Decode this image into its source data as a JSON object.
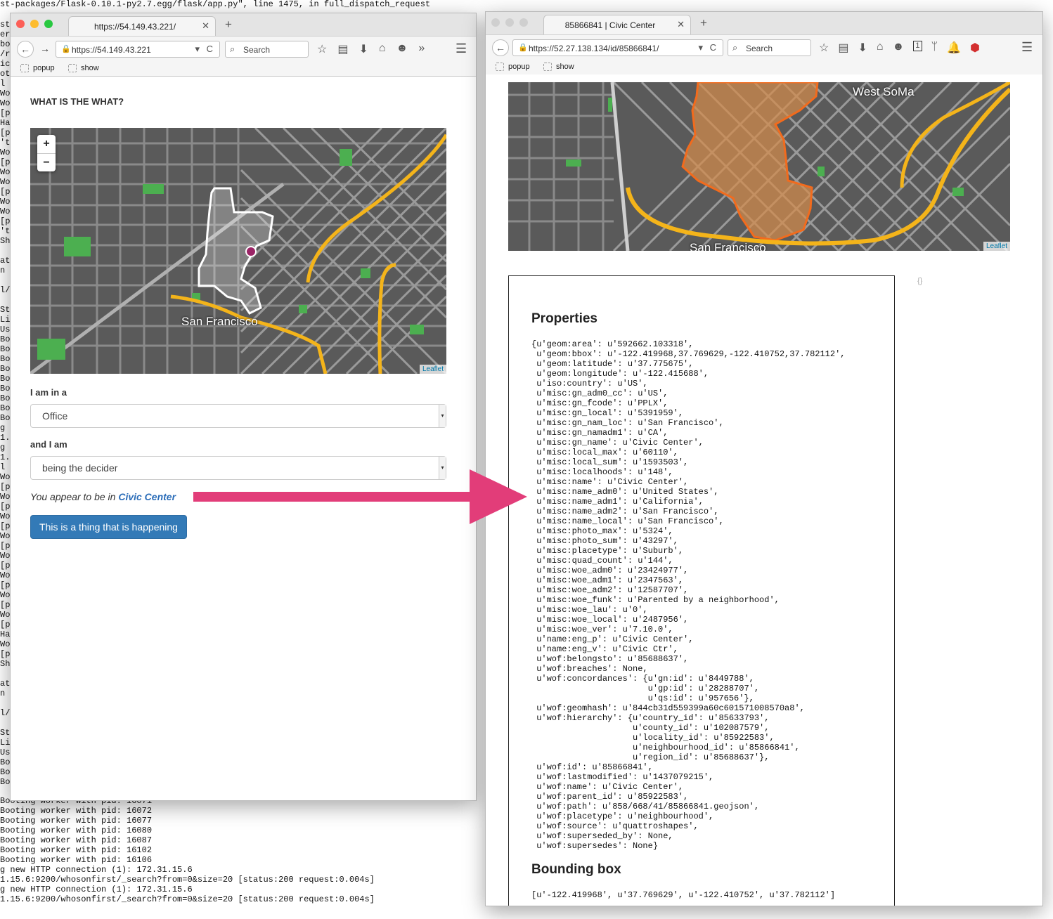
{
  "terminal": {
    "top_line": "st-packages/Flask-0.10.1-py2.7.egg/flask/app.py\", line 1475, in full_dispatch_request",
    "left_fragments": [
      "st-",
      "er",
      "bo",
      "/r",
      "ic",
      "ot",
      "l w",
      "Wor",
      "Wor",
      "[pi",
      "Har",
      "[pi",
      "'th",
      "Wor",
      "[pi",
      "Wor",
      "Wor",
      "[pi",
      "Wor",
      "Wor",
      "[pi",
      "'th",
      "Shu",
      "",
      "ate",
      "n",
      "",
      "l/m",
      "",
      "Sta",
      "Lis",
      "Usi",
      "Boo",
      "Boo",
      "Boo",
      "Boo",
      "Boo",
      "Boo",
      "Boo",
      "Boo",
      "Boo",
      "g n",
      "1.1",
      "g n",
      "1.1",
      "l w",
      "Wor",
      "[pi",
      "Wor",
      "[pi",
      "Wor",
      "[pi",
      "Wor",
      "[pi",
      "Wor",
      "[pi",
      "Wor",
      "[pi",
      "Wor",
      "[pi",
      "Wor",
      "[pi",
      "Har",
      "Wor",
      "[pi",
      "Shu",
      "",
      "ate",
      "n",
      "",
      "l/m",
      "",
      "Sta",
      "Lis",
      "Usi",
      "Boo",
      "Boo",
      "Boo"
    ],
    "bottom_lines": [
      "Booting worker with pid: 16071",
      "Booting worker with pid: 16072",
      "Booting worker with pid: 16077",
      "Booting worker with pid: 16080",
      "Booting worker with pid: 16087",
      "Booting worker with pid: 16102",
      "Booting worker with pid: 16106",
      "g new HTTP connection (1): 172.31.15.6",
      "1.15.6:9200/whosonfirst/_search?from=0&size=20 [status:200 request:0.004s]",
      "g new HTTP connection (1): 172.31.15.6",
      "1.15.6:9200/whosonfirst/_search?from=0&size=20 [status:200 request:0.004s]"
    ]
  },
  "left_browser": {
    "tab_title": "https://54.149.43.221/",
    "url": "https://54.149.43.221",
    "search_placeholder": "Search",
    "bookmarks": [
      "popup",
      "show"
    ],
    "heading": "WHAT IS THE WHAT?",
    "map": {
      "label": "San Francisco",
      "attribution": "Leaflet",
      "zoom_in": "+",
      "zoom_out": "−"
    },
    "field1_label": "I am in a",
    "field1_value": "Office",
    "field2_label": "and I am",
    "field2_value": "being the decider",
    "appear_prefix": "You appear to be in ",
    "appear_place": "Civic Center",
    "button_label": "This is a thing that is happening"
  },
  "right_browser": {
    "tab_title": "85866841 | Civic Center",
    "url": "https://52.27.138.134/id/85866841/",
    "search_placeholder": "Search",
    "badge": "1",
    "bookmarks": [
      "popup",
      "show"
    ],
    "map": {
      "label_top": "West SoMa",
      "label_bottom": "San Francisco",
      "attribution": "Leaflet"
    },
    "braces": "{}",
    "properties_heading": "Properties",
    "properties_text": "{u'geom:area': u'592662.103318',\n u'geom:bbox': u'-122.419968,37.769629,-122.410752,37.782112',\n u'geom:latitude': u'37.775675',\n u'geom:longitude': u'-122.415688',\n u'iso:country': u'US',\n u'misc:gn_adm0_cc': u'US',\n u'misc:gn_fcode': u'PPLX',\n u'misc:gn_local': u'5391959',\n u'misc:gn_nam_loc': u'San Francisco',\n u'misc:gn_namadm1': u'CA',\n u'misc:gn_name': u'Civic Center',\n u'misc:local_max': u'60110',\n u'misc:local_sum': u'1593503',\n u'misc:localhoods': u'148',\n u'misc:name': u'Civic Center',\n u'misc:name_adm0': u'United States',\n u'misc:name_adm1': u'California',\n u'misc:name_adm2': u'San Francisco',\n u'misc:name_local': u'San Francisco',\n u'misc:photo_max': u'5324',\n u'misc:photo_sum': u'43297',\n u'misc:placetype': u'Suburb',\n u'misc:quad_count': u'144',\n u'misc:woe_adm0': u'23424977',\n u'misc:woe_adm1': u'2347563',\n u'misc:woe_adm2': u'12587707',\n u'misc:woe_funk': u'Parented by a neighborhood',\n u'misc:woe_lau': u'0',\n u'misc:woe_local': u'2487956',\n u'misc:woe_ver': u'7.10.0',\n u'name:eng_p': u'Civic Center',\n u'name:eng_v': u'Civic Ctr',\n u'wof:belongsto': u'85688637',\n u'wof:breaches': None,\n u'wof:concordances': {u'gn:id': u'8449788',\n                       u'gp:id': u'28288707',\n                       u'qs:id': u'957656'},\n u'wof:geomhash': u'844cb31d559399a60c601571008570a8',\n u'wof:hierarchy': {u'country_id': u'85633793',\n                    u'county_id': u'102087579',\n                    u'locality_id': u'85922583',\n                    u'neighbourhood_id': u'85866841',\n                    u'region_id': u'85688637'},\n u'wof:id': u'85866841',\n u'wof:lastmodified': u'1437079215',\n u'wof:name': u'Civic Center',\n u'wof:parent_id': u'85922583',\n u'wof:path': u'858/668/41/85866841.geojson',\n u'wof:placetype': u'neighbourhood',\n u'wof:source': u'quattroshapes',\n u'wof:superseded_by': None,\n u'wof:supersedes': None}",
    "bbox_heading": "Bounding box",
    "bbox_text": "[u'-122.419968', u'37.769629', u'-122.410752', u'37.782112']"
  },
  "colors": {
    "arrow": "#e23d79",
    "button": "#337ab7",
    "map_base": "#555555",
    "highway": "#f4b41a",
    "polygon_outline": "#f26b1d",
    "marker": "#9b2466"
  }
}
